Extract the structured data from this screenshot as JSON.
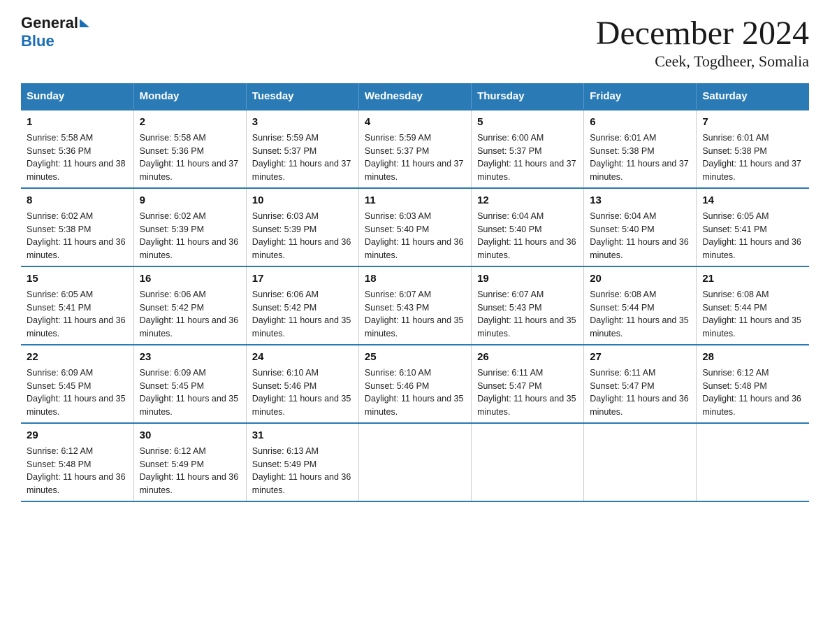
{
  "logo": {
    "general": "General",
    "blue": "Blue"
  },
  "header": {
    "month": "December 2024",
    "location": "Ceek, Togdheer, Somalia"
  },
  "weekdays": [
    "Sunday",
    "Monday",
    "Tuesday",
    "Wednesday",
    "Thursday",
    "Friday",
    "Saturday"
  ],
  "weeks": [
    [
      {
        "day": "1",
        "sunrise": "5:58 AM",
        "sunset": "5:36 PM",
        "daylight": "11 hours and 38 minutes."
      },
      {
        "day": "2",
        "sunrise": "5:58 AM",
        "sunset": "5:36 PM",
        "daylight": "11 hours and 37 minutes."
      },
      {
        "day": "3",
        "sunrise": "5:59 AM",
        "sunset": "5:37 PM",
        "daylight": "11 hours and 37 minutes."
      },
      {
        "day": "4",
        "sunrise": "5:59 AM",
        "sunset": "5:37 PM",
        "daylight": "11 hours and 37 minutes."
      },
      {
        "day": "5",
        "sunrise": "6:00 AM",
        "sunset": "5:37 PM",
        "daylight": "11 hours and 37 minutes."
      },
      {
        "day": "6",
        "sunrise": "6:01 AM",
        "sunset": "5:38 PM",
        "daylight": "11 hours and 37 minutes."
      },
      {
        "day": "7",
        "sunrise": "6:01 AM",
        "sunset": "5:38 PM",
        "daylight": "11 hours and 37 minutes."
      }
    ],
    [
      {
        "day": "8",
        "sunrise": "6:02 AM",
        "sunset": "5:38 PM",
        "daylight": "11 hours and 36 minutes."
      },
      {
        "day": "9",
        "sunrise": "6:02 AM",
        "sunset": "5:39 PM",
        "daylight": "11 hours and 36 minutes."
      },
      {
        "day": "10",
        "sunrise": "6:03 AM",
        "sunset": "5:39 PM",
        "daylight": "11 hours and 36 minutes."
      },
      {
        "day": "11",
        "sunrise": "6:03 AM",
        "sunset": "5:40 PM",
        "daylight": "11 hours and 36 minutes."
      },
      {
        "day": "12",
        "sunrise": "6:04 AM",
        "sunset": "5:40 PM",
        "daylight": "11 hours and 36 minutes."
      },
      {
        "day": "13",
        "sunrise": "6:04 AM",
        "sunset": "5:40 PM",
        "daylight": "11 hours and 36 minutes."
      },
      {
        "day": "14",
        "sunrise": "6:05 AM",
        "sunset": "5:41 PM",
        "daylight": "11 hours and 36 minutes."
      }
    ],
    [
      {
        "day": "15",
        "sunrise": "6:05 AM",
        "sunset": "5:41 PM",
        "daylight": "11 hours and 36 minutes."
      },
      {
        "day": "16",
        "sunrise": "6:06 AM",
        "sunset": "5:42 PM",
        "daylight": "11 hours and 36 minutes."
      },
      {
        "day": "17",
        "sunrise": "6:06 AM",
        "sunset": "5:42 PM",
        "daylight": "11 hours and 35 minutes."
      },
      {
        "day": "18",
        "sunrise": "6:07 AM",
        "sunset": "5:43 PM",
        "daylight": "11 hours and 35 minutes."
      },
      {
        "day": "19",
        "sunrise": "6:07 AM",
        "sunset": "5:43 PM",
        "daylight": "11 hours and 35 minutes."
      },
      {
        "day": "20",
        "sunrise": "6:08 AM",
        "sunset": "5:44 PM",
        "daylight": "11 hours and 35 minutes."
      },
      {
        "day": "21",
        "sunrise": "6:08 AM",
        "sunset": "5:44 PM",
        "daylight": "11 hours and 35 minutes."
      }
    ],
    [
      {
        "day": "22",
        "sunrise": "6:09 AM",
        "sunset": "5:45 PM",
        "daylight": "11 hours and 35 minutes."
      },
      {
        "day": "23",
        "sunrise": "6:09 AM",
        "sunset": "5:45 PM",
        "daylight": "11 hours and 35 minutes."
      },
      {
        "day": "24",
        "sunrise": "6:10 AM",
        "sunset": "5:46 PM",
        "daylight": "11 hours and 35 minutes."
      },
      {
        "day": "25",
        "sunrise": "6:10 AM",
        "sunset": "5:46 PM",
        "daylight": "11 hours and 35 minutes."
      },
      {
        "day": "26",
        "sunrise": "6:11 AM",
        "sunset": "5:47 PM",
        "daylight": "11 hours and 35 minutes."
      },
      {
        "day": "27",
        "sunrise": "6:11 AM",
        "sunset": "5:47 PM",
        "daylight": "11 hours and 36 minutes."
      },
      {
        "day": "28",
        "sunrise": "6:12 AM",
        "sunset": "5:48 PM",
        "daylight": "11 hours and 36 minutes."
      }
    ],
    [
      {
        "day": "29",
        "sunrise": "6:12 AM",
        "sunset": "5:48 PM",
        "daylight": "11 hours and 36 minutes."
      },
      {
        "day": "30",
        "sunrise": "6:12 AM",
        "sunset": "5:49 PM",
        "daylight": "11 hours and 36 minutes."
      },
      {
        "day": "31",
        "sunrise": "6:13 AM",
        "sunset": "5:49 PM",
        "daylight": "11 hours and 36 minutes."
      },
      null,
      null,
      null,
      null
    ]
  ]
}
